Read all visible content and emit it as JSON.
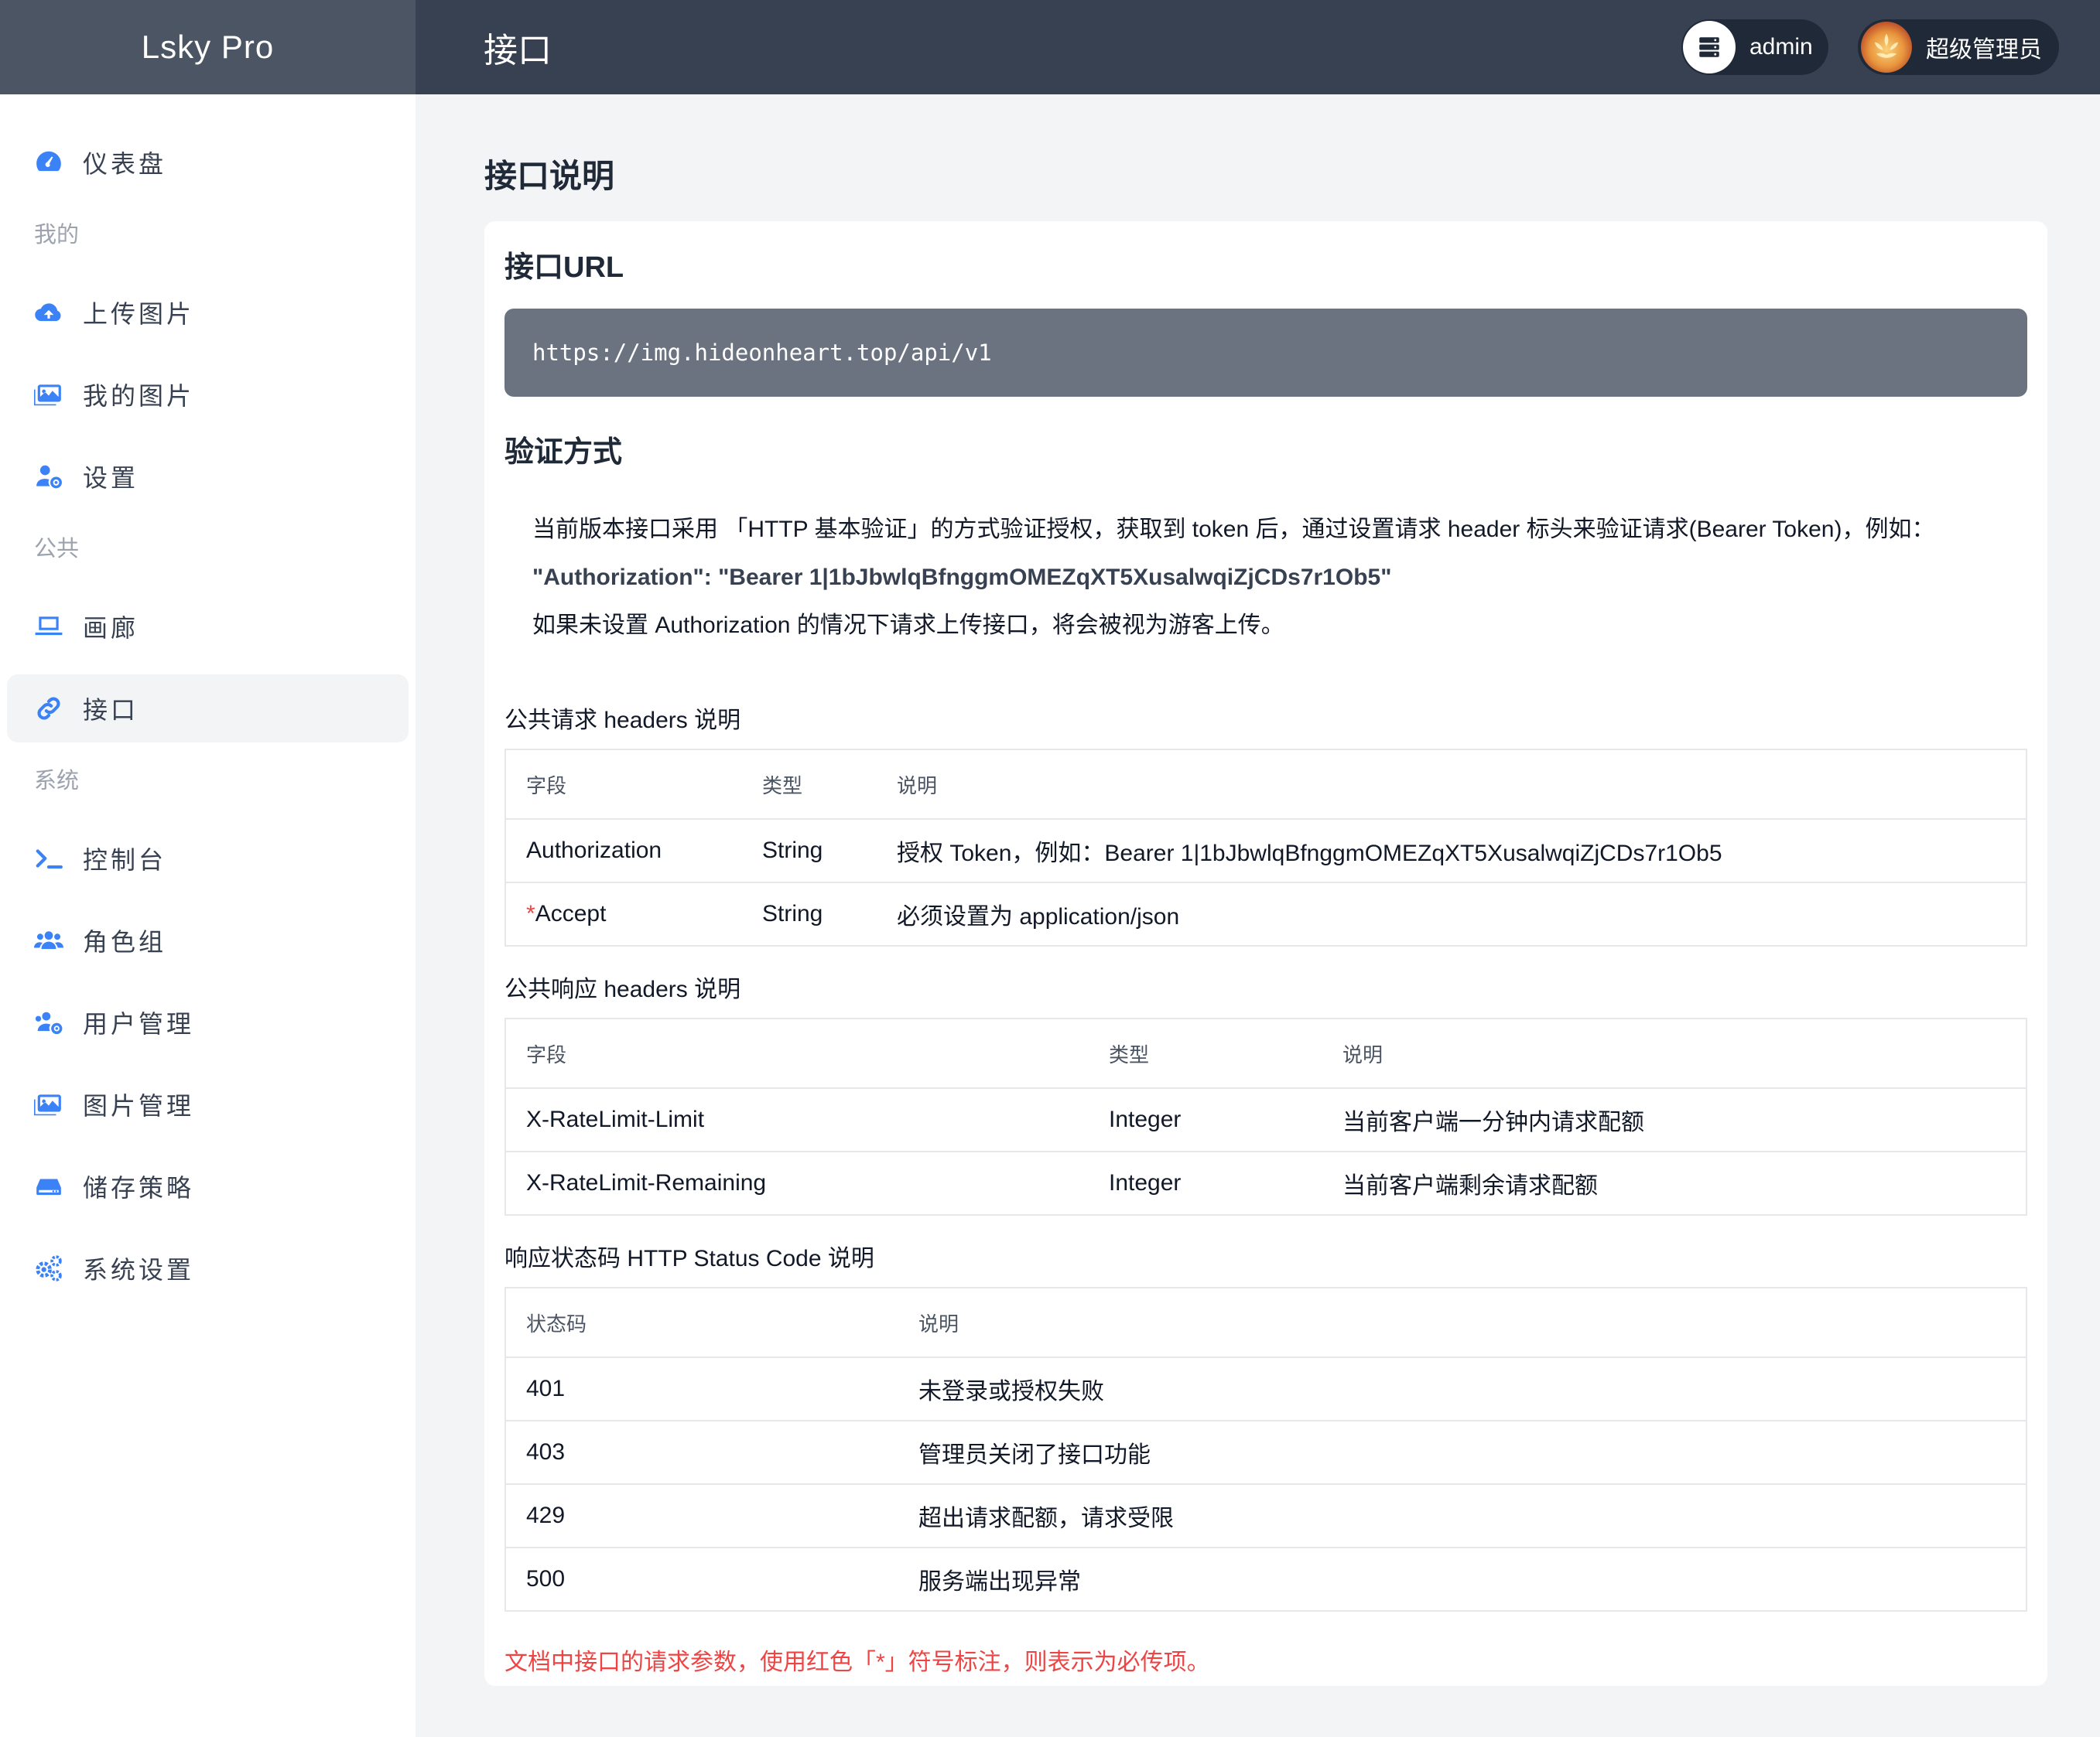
{
  "brand": "Lsky Pro",
  "header": {
    "title": "接口",
    "admin_label": "admin",
    "user_label": "超级管理员"
  },
  "sidebar": {
    "dashboard": "仪表盘",
    "group_mine": "我的",
    "upload": "上传图片",
    "my_images": "我的图片",
    "settings": "设置",
    "group_public": "公共",
    "gallery": "画廊",
    "api": "接口",
    "group_system": "系统",
    "console": "控制台",
    "roles": "角色组",
    "users": "用户管理",
    "images": "图片管理",
    "storage": "储存策略",
    "system_settings": "系统设置"
  },
  "main": {
    "page_title": "接口说明",
    "url_title": "接口URL",
    "url": "https://img.hideonheart.top/api/v1",
    "auth_title": "验证方式",
    "auth_line1": "当前版本接口采用 「HTTP 基本验证」的方式验证授权，获取到 token 后，通过设置请求 header 标头来验证请求(Bearer Token)，例如：",
    "auth_line2": "\"Authorization\": \"Bearer 1|1bJbwlqBfnggmOMEZqXT5XusalwqiZjCDs7r1Ob5\"",
    "auth_line3": "如果未设置 Authorization 的情况下请求上传接口，将会被视为游客上传。",
    "req_headers_title": "公共请求 headers 说明",
    "req_headers": {
      "columns": [
        "字段",
        "类型",
        "说明"
      ],
      "rows": [
        {
          "field": "Authorization",
          "type": "String",
          "desc": "授权 Token，例如：Bearer 1|1bJbwlqBfnggmOMEZqXT5XusalwqiZjCDs7r1Ob5"
        },
        {
          "field_mark": "*",
          "field": "Accept",
          "type": "String",
          "desc": "必须设置为 application/json"
        }
      ]
    },
    "resp_headers_title": "公共响应 headers 说明",
    "resp_headers": {
      "columns": [
        "字段",
        "类型",
        "说明"
      ],
      "rows": [
        {
          "field": "X-RateLimit-Limit",
          "type": "Integer",
          "desc": "当前客户端一分钟内请求配额"
        },
        {
          "field": "X-RateLimit-Remaining",
          "type": "Integer",
          "desc": "当前客户端剩余请求配额"
        }
      ]
    },
    "status_title": "响应状态码 HTTP Status Code 说明",
    "status": {
      "columns": [
        "状态码",
        "说明"
      ],
      "rows": [
        {
          "code": "401",
          "desc": "未登录或授权失败"
        },
        {
          "code": "403",
          "desc": "管理员关闭了接口功能"
        },
        {
          "code": "429",
          "desc": "超出请求配额，请求受限"
        },
        {
          "code": "500",
          "desc": "服务端出现异常"
        }
      ]
    },
    "note": "文档中接口的请求参数，使用红色「*」符号标注，则表示为必传项。"
  },
  "colors": {
    "accent": "#3b82f6",
    "header_bg": "#374151",
    "brand_bg": "#4b5563",
    "url_bg": "#6b7280",
    "required": "#ef4444"
  }
}
